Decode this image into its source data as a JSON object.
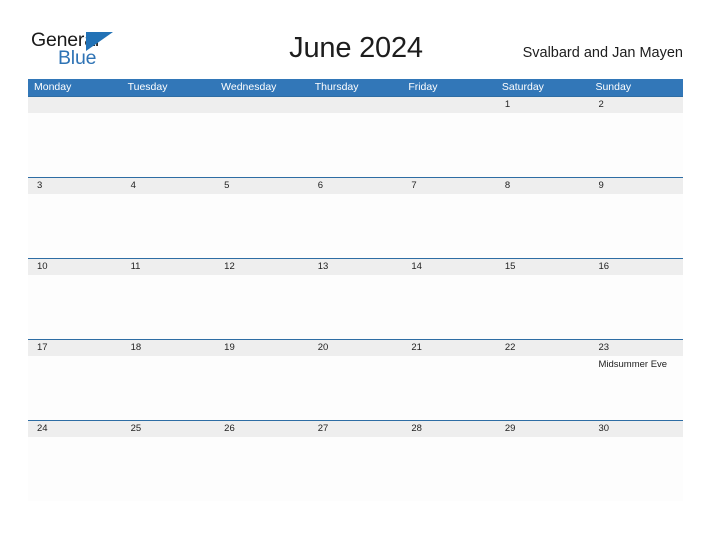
{
  "brand": {
    "name_part1": "General",
    "name_part2": "Blue",
    "triangle_icon": "triangle-icon",
    "color_primary": "#2272b6",
    "color_text": "#1a1a1a"
  },
  "header": {
    "month_title": "June 2024",
    "region": "Svalbard and Jan Mayen"
  },
  "calendar": {
    "header_background": "#3277b8",
    "date_bar_background": "#eeeeee",
    "row_border_color": "#2e6da4",
    "weekdays": [
      "Monday",
      "Tuesday",
      "Wednesday",
      "Thursday",
      "Friday",
      "Saturday",
      "Sunday"
    ],
    "weeks": [
      {
        "dates": [
          "",
          "",
          "",
          "",
          "",
          "1",
          "2"
        ],
        "events": [
          "",
          "",
          "",
          "",
          "",
          "",
          ""
        ]
      },
      {
        "dates": [
          "3",
          "4",
          "5",
          "6",
          "7",
          "8",
          "9"
        ],
        "events": [
          "",
          "",
          "",
          "",
          "",
          "",
          ""
        ]
      },
      {
        "dates": [
          "10",
          "11",
          "12",
          "13",
          "14",
          "15",
          "16"
        ],
        "events": [
          "",
          "",
          "",
          "",
          "",
          "",
          ""
        ]
      },
      {
        "dates": [
          "17",
          "18",
          "19",
          "20",
          "21",
          "22",
          "23"
        ],
        "events": [
          "",
          "",
          "",
          "",
          "",
          "",
          "Midsummer Eve"
        ]
      },
      {
        "dates": [
          "24",
          "25",
          "26",
          "27",
          "28",
          "29",
          "30"
        ],
        "events": [
          "",
          "",
          "",
          "",
          "",
          "",
          ""
        ]
      }
    ]
  }
}
